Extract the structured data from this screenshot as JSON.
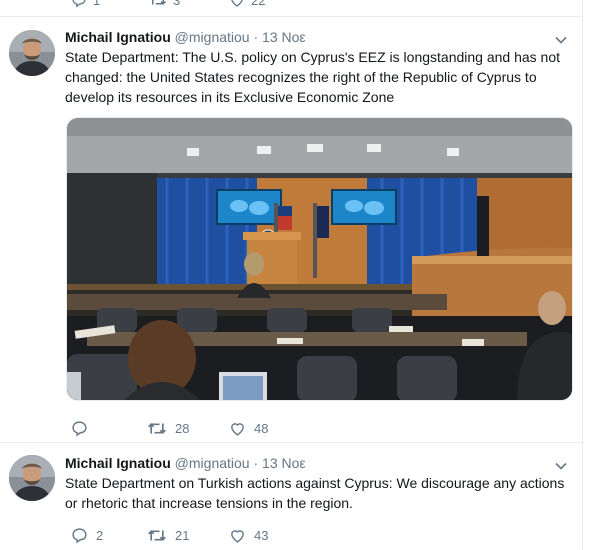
{
  "top_partial_actions": {
    "replies": "1",
    "retweets": "3",
    "likes": "22"
  },
  "tweets": [
    {
      "author": "Michail Ignatiou",
      "handle": "@mignatiou",
      "separator": "·",
      "time": "13 Νοε",
      "text": "State Department: The U.S. policy on Cyprus's EEZ is longstanding and has not changed: the United States recognizes the right of the Republic of Cyprus to develop its resources in its Exclusive Economic Zone",
      "has_media": true,
      "replies": "",
      "retweets": "28",
      "likes": "48"
    },
    {
      "author": "Michail Ignatiou",
      "handle": "@mignatiou",
      "separator": "·",
      "time": "13 Νοε",
      "text": "State Department on Turkish actions against Cyprus: We discourage any actions or rhetoric that increase tensions in the region.",
      "has_media": false,
      "replies": "2",
      "retweets": "21",
      "likes": "43"
    }
  ],
  "colors": {
    "text": "#14171a",
    "secondary": "#657786",
    "divider": "#e6ecf0",
    "curtain": "#1f4fa0",
    "screen": "#1c86c9",
    "desk": "#c07a3a"
  },
  "icons": [
    "reply-icon",
    "retweet-icon",
    "like-icon",
    "caret-down-icon"
  ]
}
